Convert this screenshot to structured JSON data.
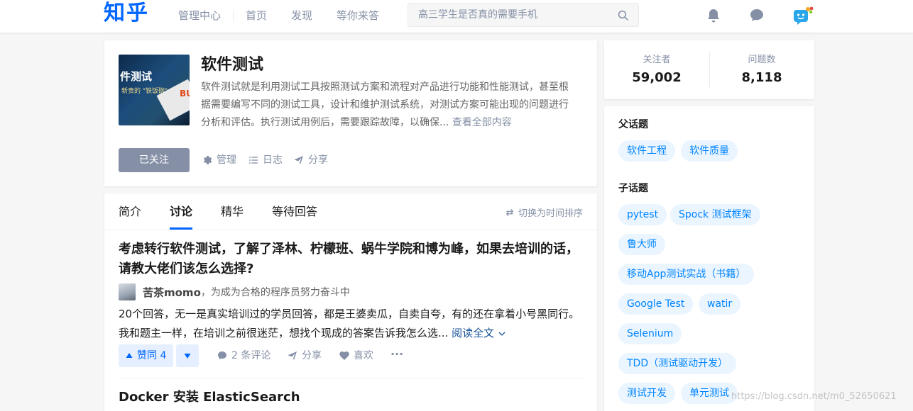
{
  "header": {
    "logo": "知乎",
    "nav": [
      "管理中心",
      "首页",
      "发现",
      "等你来答"
    ],
    "search_placeholder": "高三学生是否真的需要手机"
  },
  "topic": {
    "image_title": "件测试",
    "image_sub": "新贵的 \"铁饭碗\"",
    "image_badge": "BU",
    "title": "软件测试",
    "description": "软件测试就是利用测试工具按照测试方案和流程对产品进行功能和性能测试，甚至根据需要编写不同的测试工具，设计和维护测试系统，对测试方案可能出现的问题进行分析和评估。执行测试用例后，需要跟踪故障，以确保...",
    "read_all": "查看全部内容",
    "follow_label": "已关注",
    "manage_label": "管理",
    "log_label": "日志",
    "share_label": "分享"
  },
  "feed": {
    "tabs": [
      "简介",
      "讨论",
      "精华",
      "等待回答"
    ],
    "active_tab": "讨论",
    "sort_label": "切换为时间排序",
    "item1": {
      "title": "考虑转行软件测试，了解了泽林、柠檬班、蜗牛学院和博为峰，如果去培训的话，请教大佬们该怎么选择?",
      "author": "苦茶momo",
      "bio": "，为成为合格的程序员努力奋斗中",
      "excerpt": "20个回答，无一是真实培训过的学员回答，都是王婆卖瓜，自卖自夸，有的还在拿着小号黑同行。我和题主一样，在培训之前很迷茫，想找个现成的答案告诉我怎么选...",
      "read_more": "阅读全文",
      "vote_label": "赞同 4",
      "comments": "2 条评论",
      "share": "分享",
      "like": "喜欢",
      "more": "···"
    },
    "item2": {
      "title": "Docker 安装 ElasticSearch"
    }
  },
  "sidebar": {
    "followers_label": "关注者",
    "followers": "59,002",
    "questions_label": "问题数",
    "questions": "8,118",
    "parent_title": "父话题",
    "parent_tags": [
      "软件工程",
      "软件质量"
    ],
    "child_title": "子话题",
    "child_tags": [
      "pytest",
      "Spock 测试框架",
      "鲁大师",
      "移动App测试实战（书籍）",
      "Google Test",
      "watir",
      "Selenium",
      "TDD（测试驱动开发）",
      "测试开发",
      "单元测试"
    ]
  },
  "watermark": "https://blog.csdn.net/m0_52650621",
  "colors": {
    "brand": "#0066ff",
    "tag_bg": "#ebf5ff",
    "tag_text": "#0084ff",
    "muted": "#8590a6"
  }
}
